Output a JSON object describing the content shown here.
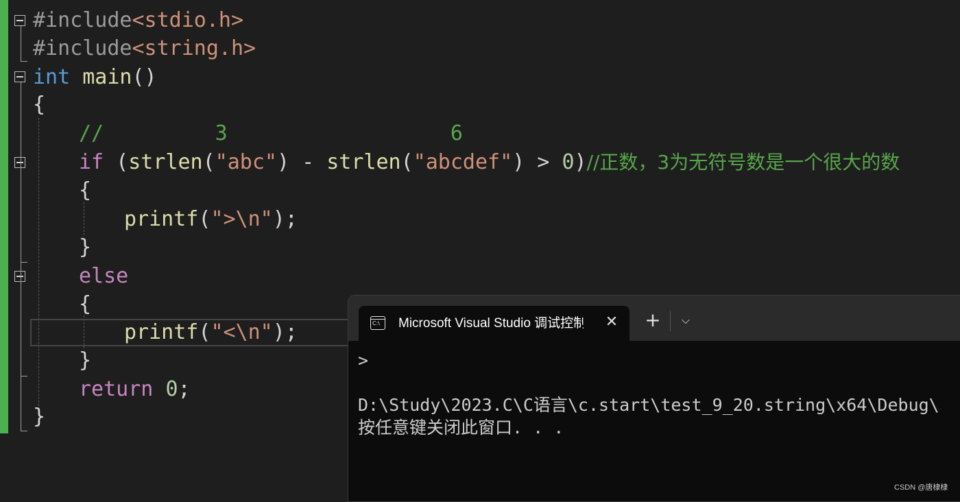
{
  "editor": {
    "line1": {
      "directive": "#include",
      "header": "<stdio.h>"
    },
    "line2": {
      "directive": "#include",
      "header": "<string.h>"
    },
    "line3": {
      "type": "int",
      "func": "main",
      "paren": "()"
    },
    "line4": "{",
    "line5": {
      "comment": "//         3                  6"
    },
    "line6": {
      "if": "if",
      "p1": " (",
      "strlen1": "strlen",
      "p2": "(",
      "s1": "\"abc\"",
      "p3": ") - ",
      "strlen2": "strlen",
      "p4": "(",
      "s2": "\"abcdef\"",
      "p5": ") > ",
      "zero": "0",
      "p6": ")",
      "comment": "//正数，3为无符号数是一个很大的数"
    },
    "line7": "{",
    "line8": {
      "fn": "printf",
      "p1": "(",
      "s": "\">\\n\"",
      "p2": ");"
    },
    "line9": "}",
    "line10": {
      "kw": "else"
    },
    "line11": "{",
    "line12": {
      "fn": "printf",
      "p1": "(",
      "s": "\"<\\n\"",
      "p2": ");"
    },
    "line13": "}",
    "line14": {
      "kw": "return",
      "num": "0",
      "semi": ";"
    },
    "line15": "}"
  },
  "console": {
    "tab_title": "Microsoft Visual Studio 调试控制台",
    "tab_icon_text": "C:\\",
    "close_glyph": "✕",
    "new_tab_glyph": "+",
    "dropdown_glyph": "⌵",
    "prompt": ">",
    "path_line": "D:\\Study\\2023.C\\C语言\\c.start\\test_9_20.string\\x64\\Debug\\",
    "exit_line": "按任意键关闭此窗口. . ."
  },
  "watermark": "CSDN @唐棣棣",
  "colors": {
    "keyword": "#569cd6",
    "control": "#c586c0",
    "function": "#dcdcaa",
    "string": "#ce9178",
    "comment": "#57a64a",
    "number": "#b5cea8",
    "gutter_bar": "#4caf50"
  }
}
